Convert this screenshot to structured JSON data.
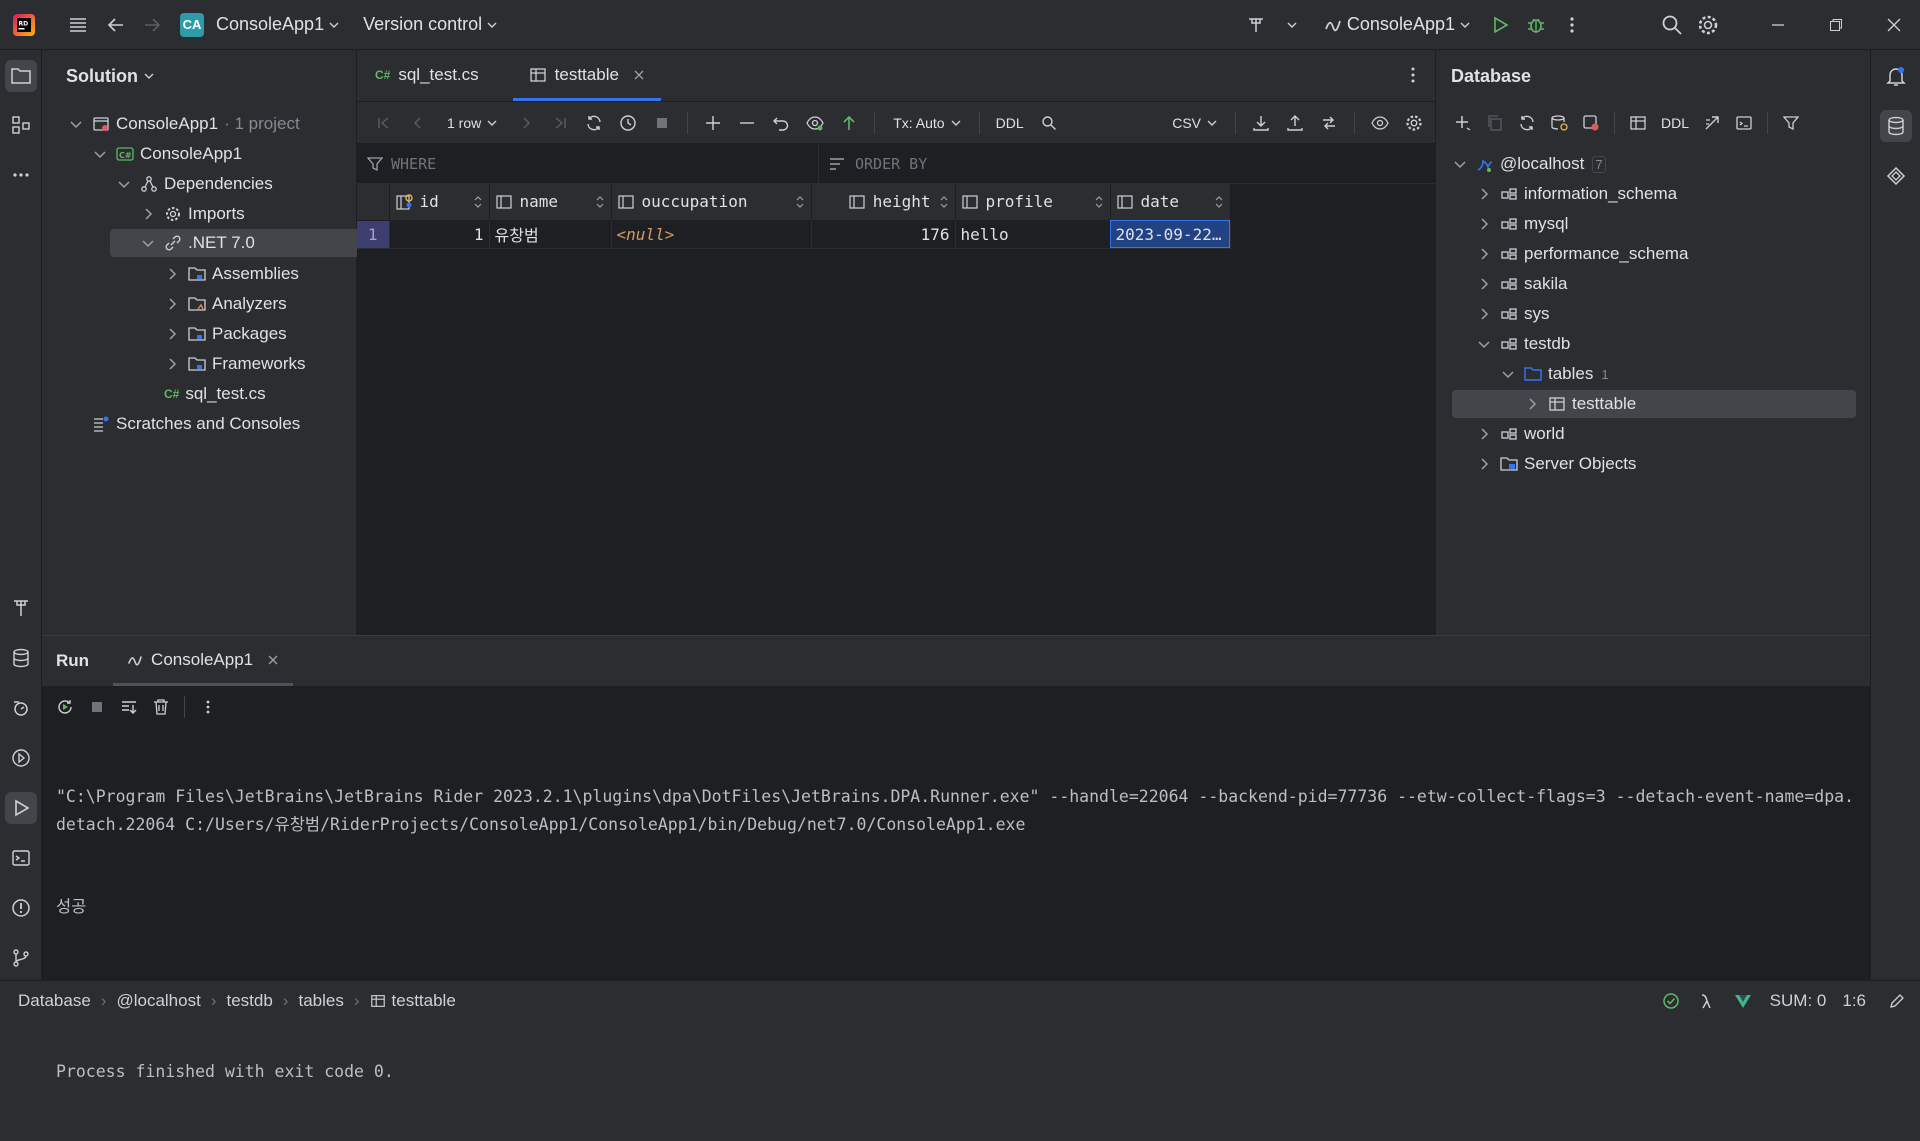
{
  "titlebar": {
    "project_badge": "CA",
    "project_name": "ConsoleApp1",
    "vcs": "Version control",
    "run_config": "ConsoleApp1"
  },
  "solution": {
    "header": "Solution",
    "tree": [
      {
        "label": "ConsoleApp1",
        "suffix": "· 1 project"
      },
      {
        "label": "ConsoleApp1"
      },
      {
        "label": "Dependencies"
      },
      {
        "label": "Imports"
      },
      {
        "label": ".NET 7.0"
      },
      {
        "label": "Assemblies"
      },
      {
        "label": "Analyzers"
      },
      {
        "label": "Packages"
      },
      {
        "label": "Frameworks"
      },
      {
        "label": "sql_test.cs"
      },
      {
        "label": "Scratches and Consoles"
      }
    ]
  },
  "editor": {
    "tabs": [
      {
        "label": "sql_test.cs"
      },
      {
        "label": "testtable"
      }
    ],
    "toolbar": {
      "rows": "1 row",
      "tx": "Tx: Auto",
      "ddl": "DDL",
      "export_format": "CSV"
    },
    "filter": {
      "where": "WHERE",
      "order_by": "ORDER BY"
    },
    "grid": {
      "columns": [
        "id",
        "name",
        "ouccupation",
        "height",
        "profile",
        "date"
      ],
      "rows": [
        {
          "num": "1",
          "id": "1",
          "name": "유창범",
          "ouccupation": "<null>",
          "height": "176",
          "profile": "hello",
          "date": "2023-09-22…"
        }
      ]
    }
  },
  "database": {
    "header": "Database",
    "ddl": "DDL",
    "host": "@localhost",
    "host_count": "7",
    "schemas": [
      "information_schema",
      "mysql",
      "performance_schema",
      "sakila",
      "sys",
      "testdb"
    ],
    "tables_label": "tables",
    "tables_count": "1",
    "table": "testtable",
    "after": [
      "world",
      "Server Objects"
    ]
  },
  "run": {
    "tab_run": "Run",
    "tab_app": "ConsoleApp1",
    "lines": [
      "\"C:\\Program Files\\JetBrains\\JetBrains Rider 2023.2.1\\plugins\\dpa\\DotFiles\\JetBrains.DPA.Runner.exe\" --handle=22064 --backend-pid=77736 --etw-collect-flags=3 --detach-event-name=dpa.detach.22064 C:/Users/유창범/RiderProjects/ConsoleApp1/ConsoleApp1/bin/Debug/net7.0/ConsoleApp1.exe",
      "성공",
      "",
      "Process finished with exit code 0."
    ]
  },
  "statusbar": {
    "crumbs": [
      "Database",
      "@localhost",
      "testdb",
      "tables",
      "testtable"
    ],
    "sum": "SUM: 0",
    "pos": "1:6"
  },
  "colors": {
    "accent": "#3574f0",
    "selection": "#214283",
    "null": "#d19a66"
  }
}
